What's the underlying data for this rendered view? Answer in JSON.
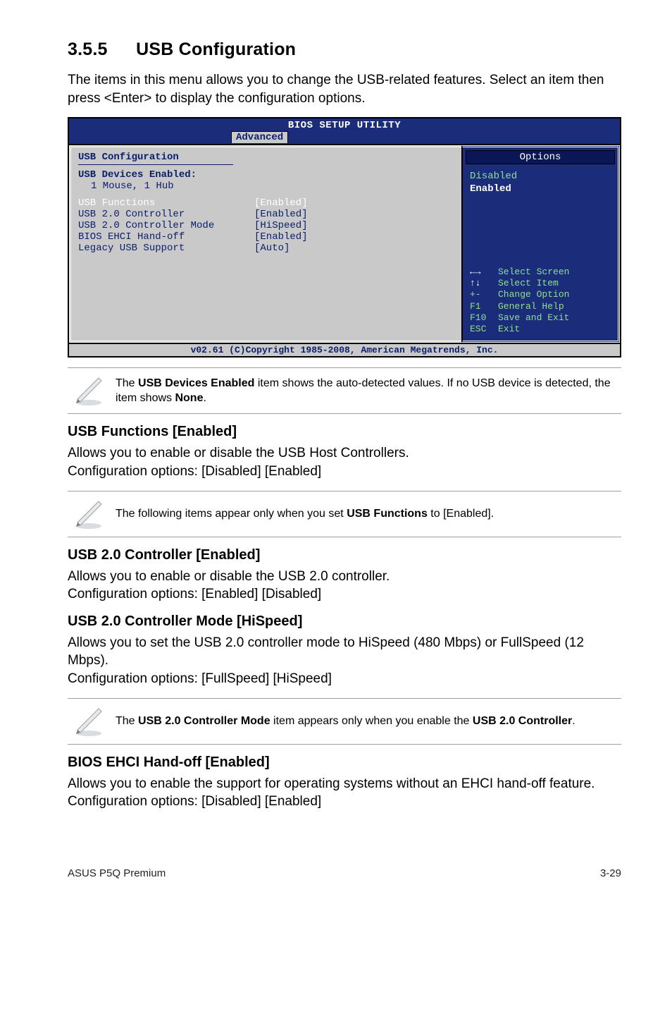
{
  "section": {
    "number": "3.5.5",
    "title": "USB Configuration",
    "intro": "The items in this menu allows you to change the USB-related features. Select an item then press <Enter> to display the configuration options."
  },
  "bios": {
    "title": "BIOS SETUP UTILITY",
    "tab": "Advanced",
    "panel_heading": "USB Configuration",
    "devices_label": "USB Devices Enabled:",
    "devices_value": "1 Mouse, 1 Hub",
    "rows": [
      {
        "k": "USB Functions",
        "v": "[Enabled]",
        "white": true
      },
      {
        "k": "USB 2.0 Controller",
        "v": "[Enabled]",
        "white": false
      },
      {
        "k": "USB 2.0 Controller Mode",
        "v": "[HiSpeed]",
        "white": false
      },
      {
        "k": "BIOS EHCI Hand-off",
        "v": "[Enabled]",
        "white": false
      },
      {
        "k": "Legacy USB Support",
        "v": "[Auto]",
        "white": false
      }
    ],
    "options_header": "Options",
    "options": {
      "a": "Disabled",
      "b": "Enabled"
    },
    "legend": {
      "l1": "Select Screen",
      "l2": "Select Item",
      "l3k": "+-",
      "l3": "Change Option",
      "l4k": "F1",
      "l4": "General Help",
      "l5k": "F10",
      "l5": "Save and Exit",
      "l6k": "ESC",
      "l6": "Exit"
    },
    "footer": "v02.61 (C)Copyright 1985-2008, American Megatrends, Inc."
  },
  "notes": {
    "n1a": "The ",
    "n1b": "USB Devices Enabled",
    "n1c": " item shows the auto-detected values. If no USB device is detected, the item shows ",
    "n1d": "None",
    "n1e": ".",
    "n2a": "The following items appear only when you set ",
    "n2b": "USB Functions",
    "n2c": " to [Enabled].",
    "n3a": "The ",
    "n3b": "USB 2.0 Controller Mode",
    "n3c": " item appears only when you enable the ",
    "n3d": "USB 2.0 Controller",
    "n3e": "."
  },
  "sub": {
    "s1_head": "USB Functions [Enabled]",
    "s1_p1": "Allows you to enable or disable the USB Host Controllers.",
    "s1_p2": "Configuration options: [Disabled] [Enabled]",
    "s2_head": "USB 2.0 Controller [Enabled]",
    "s2_p1": "Allows you to enable or disable the USB 2.0 controller.",
    "s2_p2": "Configuration options: [Enabled] [Disabled]",
    "s3_head": "USB 2.0 Controller Mode [HiSpeed]",
    "s3_p1": "Allows you to set the USB 2.0 controller mode to HiSpeed (480 Mbps) or FullSpeed (12 Mbps).",
    "s3_p2": "Configuration options: [FullSpeed] [HiSpeed]",
    "s4_head": "BIOS EHCI Hand-off [Enabled]",
    "s4_p1": "Allows you to enable the support for operating systems without an EHCI hand-off feature.",
    "s4_p2": "Configuration options: [Disabled] [Enabled]"
  },
  "footer": {
    "left": "ASUS P5Q Premium",
    "right": "3-29"
  }
}
